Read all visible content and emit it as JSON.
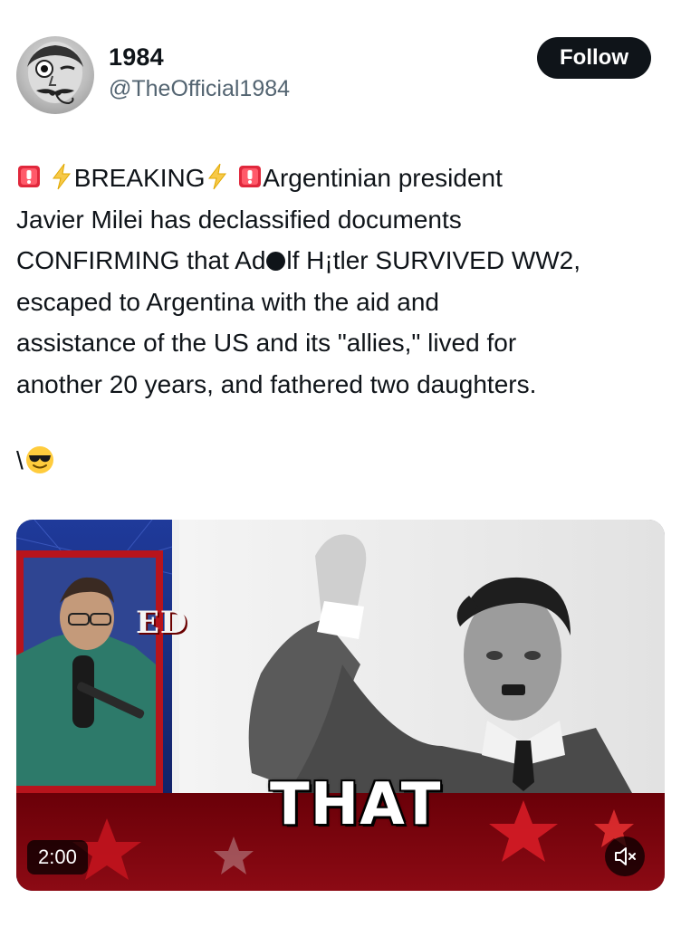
{
  "author": {
    "display_name": "1984",
    "handle": "@TheOfficial1984",
    "avatar_icon": "avatar-caricature-icon"
  },
  "follow_button": {
    "label": "Follow"
  },
  "tweet": {
    "segments": {
      "breaking": "BREAKING",
      "rest_line1": "Argentinian president",
      "line2": "Javier Milei has declassified documents",
      "line3_a": "CONFIRMING that Ad",
      "line3_b": "lf H¡tler SURVIVED WW2,",
      "line4": "escaped to Argentina with the aid and",
      "line5": "assistance of the US and its \"allies,\" lived for",
      "line6": "another 20 years, and fathered two daughters."
    },
    "trailing": "\\"
  },
  "emojis": [
    "siren-emoji",
    "lightning-emoji",
    "lightning-emoji",
    "siren-emoji",
    "sunglasses-face-emoji"
  ],
  "media": {
    "duration": "2:00",
    "caption": "THAT",
    "overlay_text": "ED",
    "mute_icon": "muted-speaker-icon"
  },
  "colors": {
    "follow_bg": "#0f1419",
    "handle_gray": "#536471",
    "siren_red": "#e0283c",
    "lightning_yellow": "#f7c948"
  }
}
